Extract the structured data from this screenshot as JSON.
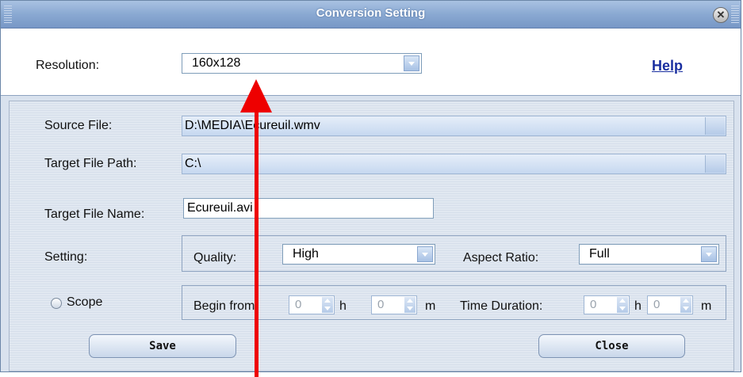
{
  "window": {
    "title": "Conversion Setting"
  },
  "resolution": {
    "label": "Resolution:",
    "value": "160x128"
  },
  "help_link": "Help",
  "source_file": {
    "label": "Source File:",
    "value": "D:\\MEDIA\\Ecureuil.wmv"
  },
  "target_path": {
    "label": "Target File Path:",
    "value": "C:\\"
  },
  "target_name": {
    "label": "Target File Name:",
    "value": "Ecureuil.avi"
  },
  "setting": {
    "label": "Setting:",
    "quality_label": "Quality:",
    "quality_value": "High",
    "aspect_label": "Aspect Ratio:",
    "aspect_value": "Full"
  },
  "scope": {
    "label": "Scope",
    "begin_label": "Begin from:",
    "begin_h": "0",
    "h_unit": "h",
    "begin_m": "0",
    "m_unit": "m",
    "duration_label": "Time Duration:",
    "duration_h": "0",
    "duration_m": "0"
  },
  "buttons": {
    "save": "Save",
    "close": "Close"
  },
  "annotation_color": "#ee0000"
}
